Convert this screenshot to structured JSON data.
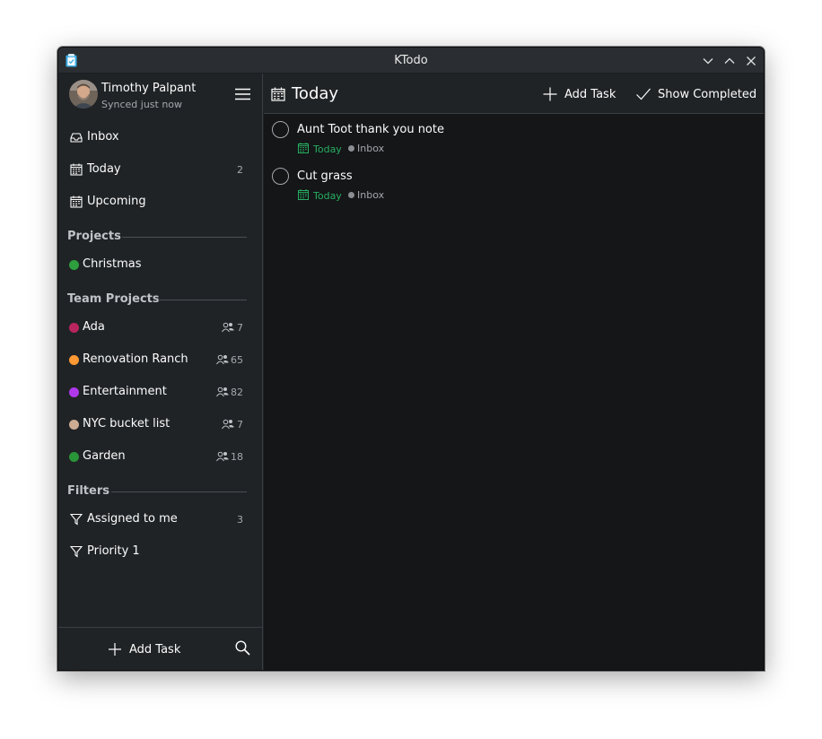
{
  "window": {
    "title": "KTodo"
  },
  "user": {
    "name": "Timothy Palpant",
    "status": "Synced just now"
  },
  "nav": [
    {
      "label": "Inbox",
      "icon": "inbox-icon",
      "count": ""
    },
    {
      "label": "Today",
      "icon": "calendar-icon",
      "count": "2"
    },
    {
      "label": "Upcoming",
      "icon": "calendar-icon",
      "count": ""
    }
  ],
  "projects": {
    "heading": "Projects",
    "items": [
      {
        "label": "Christmas",
        "color": "#2e9e3f"
      }
    ]
  },
  "team_projects": {
    "heading": "Team Projects",
    "items": [
      {
        "label": "Ada",
        "color": "#b8255f",
        "count": "7"
      },
      {
        "label": "Renovation Ranch",
        "color": "#ff9933",
        "count": "65"
      },
      {
        "label": "Entertainment",
        "color": "#af38eb",
        "count": "82"
      },
      {
        "label": "NYC bucket list",
        "color": "#ccac93",
        "count": "7"
      },
      {
        "label": "Garden",
        "color": "#299438",
        "count": "18"
      }
    ]
  },
  "filters": {
    "heading": "Filters",
    "items": [
      {
        "label": "Assigned to me",
        "count": "3",
        "icon": "filter-icon"
      },
      {
        "label": "Priority 1",
        "count": "",
        "icon": "filter-icon"
      }
    ]
  },
  "sidebar_footer": {
    "add_label": "Add Task"
  },
  "main": {
    "title": "Today",
    "add_label": "Add Task",
    "show_completed_label": "Show Completed",
    "tasks": [
      {
        "title": "Aunt Toot thank you note",
        "due": "Today",
        "project": "Inbox"
      },
      {
        "title": "Cut grass",
        "due": "Today",
        "project": "Inbox"
      }
    ]
  },
  "colors": {
    "accent_green": "#27ae60",
    "background": "#202326",
    "main_background": "#141618"
  }
}
